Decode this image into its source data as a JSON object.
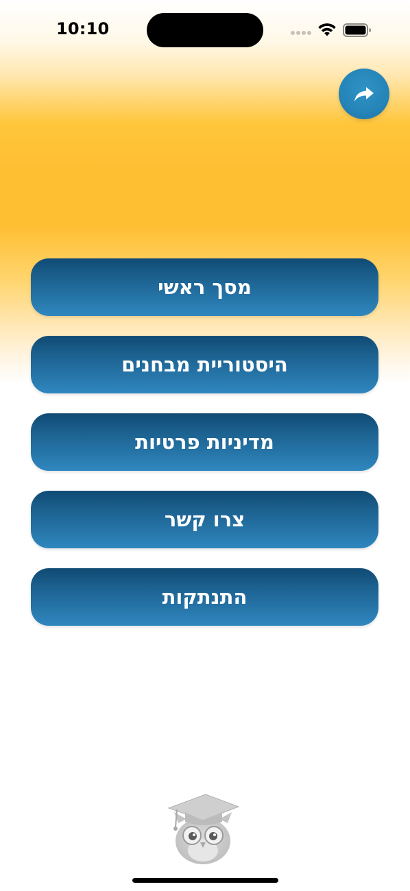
{
  "status_bar": {
    "time": "10:10",
    "icons": [
      "cellular-dots-icon",
      "wifi-icon",
      "battery-icon"
    ]
  },
  "share": {
    "icon": "share-arrow-icon",
    "color": "#2584b8"
  },
  "menu": {
    "items": [
      {
        "label": "מסך ראשי"
      },
      {
        "label": "היסטוריית מבחנים"
      },
      {
        "label": "מדיניות פרטיות"
      },
      {
        "label": "צרו קשר"
      },
      {
        "label": "התנתקות"
      }
    ],
    "button_gradient_top": "#0f4a73",
    "button_gradient_bottom": "#2f87bf",
    "label_color": "#ffffff"
  },
  "theme": {
    "band_color": "#ffbf33",
    "background": "#ffffff"
  },
  "mascot": {
    "icon": "owl-graduation-cap-icon"
  }
}
